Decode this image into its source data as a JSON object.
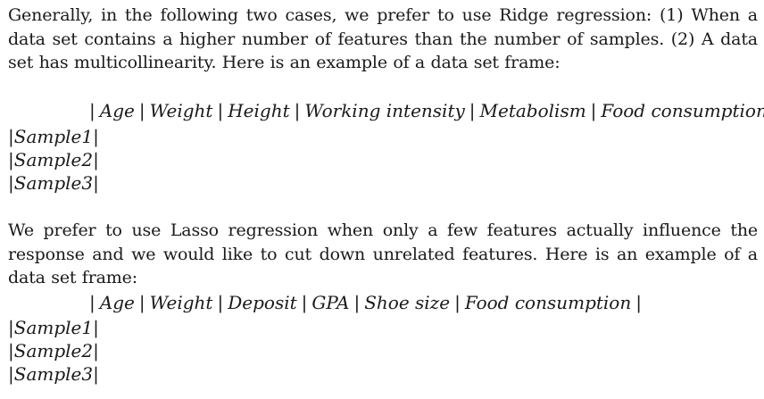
{
  "paragraph1": "Generally, in the following two cases, we prefer to use Ridge regression: (1) When a data set contains a higher number of features than the number of samples. (2) A data set has multicollinearity. Here is an example of a data set frame:",
  "table1": {
    "bar": "|",
    "headers": [
      "Age",
      "Weight",
      "Height",
      "Working intensity",
      "Metabolism",
      "Food consumption"
    ],
    "samples": [
      "Sample1",
      "Sample2",
      "Sample3"
    ]
  },
  "paragraph2": "We prefer to use Lasso regression when only a few features actually influence the response and we would like to cut down unrelated features. Here is an example of a data set frame:",
  "table2": {
    "bar": "|",
    "headers": [
      "Age",
      "Weight",
      "Deposit",
      "GPA",
      "Shoe size",
      "Food consumption"
    ],
    "samples": [
      "Sample1",
      "Sample2",
      "Sample3"
    ]
  }
}
